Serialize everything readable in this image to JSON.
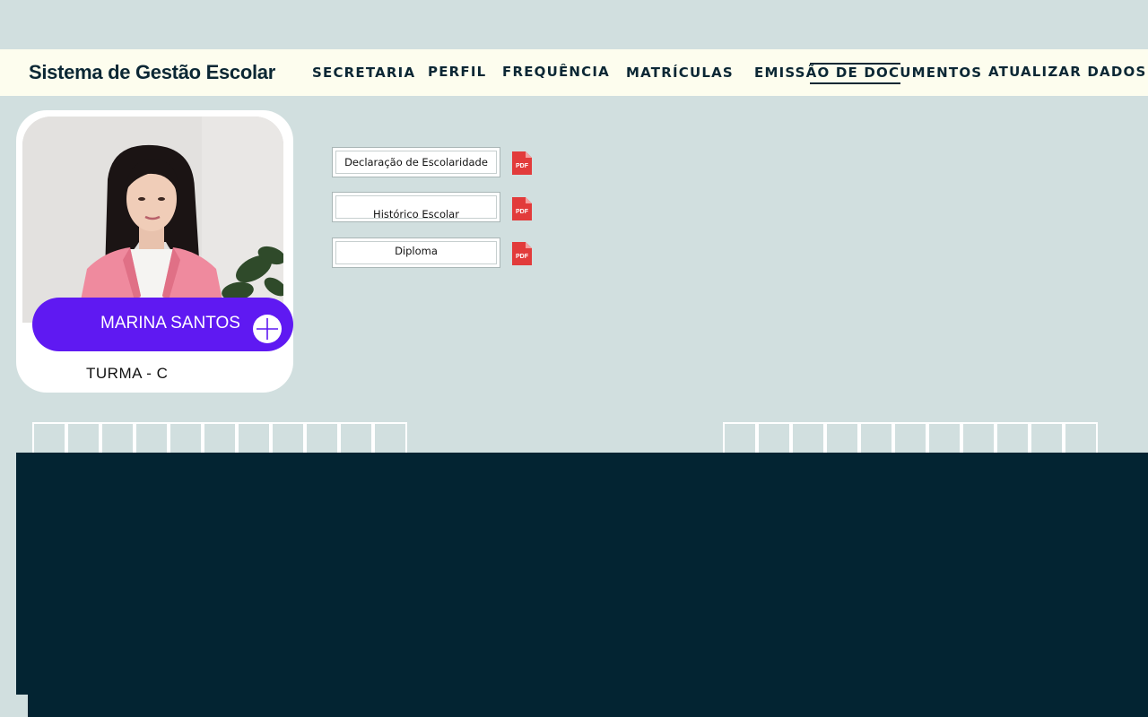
{
  "app": {
    "title": "Sistema de Gestão Escolar"
  },
  "nav": {
    "items": [
      "SECRETARIA",
      "PERFIL",
      "FREQUÊNCIA",
      "MATRÍCULAS",
      "EMISSÃO DE DOCUMENTOS",
      "ATUALIZAR DADOS"
    ],
    "active": "EMISSÃO DE DOCUMENTOS"
  },
  "profile": {
    "name": "MARINA SANTOS",
    "class": "TURMA - C",
    "pill_color": "#5f19f2"
  },
  "documents": [
    {
      "label": "Declaração de Escolaridade",
      "icon": "pdf-icon",
      "icon_text": "PDF"
    },
    {
      "label": "Histórico Escolar",
      "icon": "pdf-icon",
      "icon_text": "PDF"
    },
    {
      "label": "Diploma",
      "icon": "pdf-icon",
      "icon_text": "PDF"
    }
  ],
  "colors": {
    "background": "#d1dfdf",
    "navbar": "#fdfdee",
    "text_dark": "#0b2734",
    "panel": "#032432",
    "pdf_red": "#e23b3b"
  }
}
